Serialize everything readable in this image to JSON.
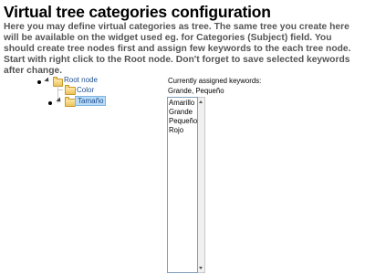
{
  "page": {
    "title": "Virtual tree categories configuration",
    "intro": "Here you may define virtual categories as tree. The same tree you create here will be available on the widget used eg. for Categories (Subject) field. You should create tree nodes first and assign few keywords to the each tree node. Start with right click to the Root node. Don't forget to save selected keywords after change."
  },
  "tree": {
    "root": {
      "label": "Root node",
      "icon": "folder-icon"
    },
    "children": [
      {
        "label": "Color",
        "icon": "folder-icon",
        "selected": false
      },
      {
        "label": "Tamaño",
        "icon": "folder-icon",
        "selected": true
      }
    ]
  },
  "keywords": {
    "caption": "Currently assigned keywords:",
    "assigned": "Grande, Pequeño",
    "options": [
      "Amarillo",
      "Grande",
      "Pequeño",
      "Rojo"
    ]
  }
}
